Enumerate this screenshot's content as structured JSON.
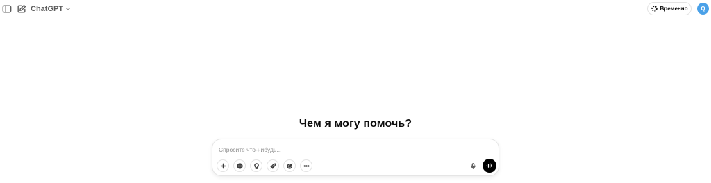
{
  "header": {
    "model_name": "ChatGPT",
    "temporary_label": "Временно",
    "avatar_initial": "Q",
    "avatar_color": "#4aa1e8"
  },
  "icons": {
    "sidebar": "sidebar-toggle-icon",
    "new_chat": "edit-icon",
    "model_dropdown": "chevron-down-icon",
    "temporary": "dashed-circle-icon",
    "tools": [
      "plus-icon",
      "globe-icon",
      "lightbulb-icon",
      "rocket-icon",
      "target-icon",
      "more-icon"
    ],
    "mic": "microphone-icon",
    "voice": "voice-waveform-icon"
  },
  "main": {
    "heading": "Чем я могу помочь?"
  },
  "composer": {
    "placeholder": "Спросите что-нибудь...",
    "value": ""
  }
}
